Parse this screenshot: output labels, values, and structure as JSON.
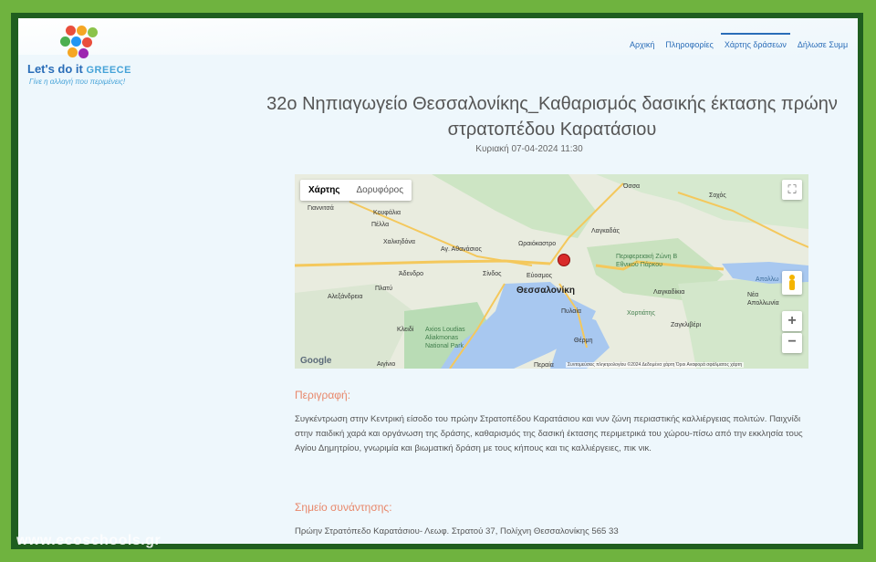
{
  "logo": {
    "title_main": "Let's do it ",
    "title_accent": "GREECE",
    "subtitle": "Γίνε η αλλαγή που περιμένεις!"
  },
  "nav": {
    "items": [
      {
        "label": "Αρχική"
      },
      {
        "label": "Πληροφορίες"
      },
      {
        "label": "Χάρτης δράσεων"
      },
      {
        "label": "Δήλωσε Συμμ"
      }
    ],
    "active_index": 2
  },
  "event": {
    "title": "32ο Νηπιαγωγείο Θεσσαλονίκης_Καθαρισμός δασικής έκτασης πρώην στρατοπέδου Καρατάσιου",
    "date": "Κυριακή 07-04-2024 11:30"
  },
  "map": {
    "tabs": [
      {
        "label": "Χάρτης"
      },
      {
        "label": "Δορυφόρος"
      }
    ],
    "selected_tab": 0,
    "google_label": "Google",
    "attribution": "Συντομεύσεις πληκτρολογίου   ©2024 Δεδομένα χάρτη   Όροι   Αναφορά σφάλματος χάρτη",
    "labels": {
      "thessaloniki": "Θεσσαλονίκη",
      "giannitsa": "Γιαννιτσά",
      "koufalia": "Κουφάλια",
      "pella": "Πέλλα",
      "chalkidona": "Χαλκηδόνα",
      "athanasios": "Αγ. Αθανάσιος",
      "oraiokastro": "Ωραιόκαστρο",
      "lagkadas": "Λαγκαδάς",
      "ossa": "Όσσα",
      "sochos": "Σοχός",
      "adendro": "Άδενδρο",
      "sindos": "Σίνδος",
      "efkarpia": "Εύοσμος",
      "platy": "Πλατύ",
      "alexandreia": "Αλεξάνδρεια",
      "kleidi": "Κλειδί",
      "aigini": "Αιγίνιο",
      "axios": "Axios Loudias Aliakmonas National Park",
      "perifereiaki": "Περιφερειακή Ζώνη Β Εθνικού Πάρκου",
      "lagkadikia": "Λαγκαδίκια",
      "nea_apollonia": "Νέα Απολλωνία",
      "chortiatis": "Χορτιάτης",
      "pylaia": "Πυλαία",
      "thermi": "Θέρμη",
      "zagkliveri": "Ζαγκλιβέρι",
      "peraia": "Περαία",
      "apollo": "Απολλω"
    }
  },
  "description": {
    "heading": "Περιγραφή:",
    "text": "Συγκέντρωση στην Κεντρική είσοδο του πρώην Στρατοπέδου Καρατάσιου και νυν ζώνη περιαστικής καλλιέργειας πολιτών. Παιχνίδι στην παιδική χαρά και οργάνωση της δράσης, καθαρισμός της δασική έκτασης περιμετρικά του χώρου-πίσω από την εκκλησία τους Αγίου Δημητρίου, γνωριμία και βιωματική δράση με τους κήπους και τις καλλιέργειες, πικ νικ."
  },
  "meeting": {
    "heading": "Σημείο συνάντησης:",
    "address": "Πρώην Στρατόπεδο Καρατάσιου- Λεωφ. Στρατού 37, Πολίχνη Θεσσαλονίκης 565 33"
  },
  "watermark": "www.ecoschools.gr",
  "colors": {
    "accent_blue": "#2a6db8",
    "heading_orange": "#e8876a",
    "frame_green": "#6fb33f",
    "pin_red": "#d92b2b"
  }
}
